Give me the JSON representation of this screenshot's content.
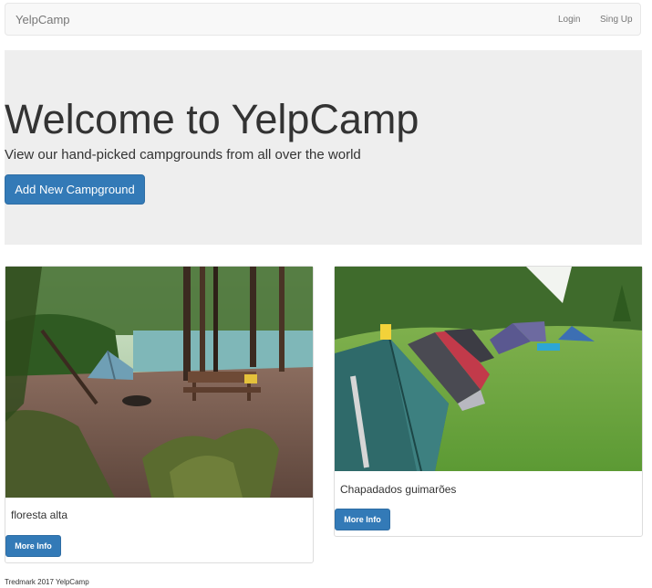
{
  "navbar": {
    "brand": "YelpCamp",
    "login": "Login",
    "signup": "Sing Up"
  },
  "jumbotron": {
    "title": "Welcome to YelpCamp",
    "subtitle": "View our hand-picked campgrounds from all over the world",
    "add_button": "Add New Campground"
  },
  "campgrounds": [
    {
      "name": "floresta alta",
      "button": "More Info"
    },
    {
      "name": "Chapadados guimarões",
      "button": "More Info"
    }
  ],
  "footer": {
    "text": "Tredmark 2017 YelpCamp"
  }
}
